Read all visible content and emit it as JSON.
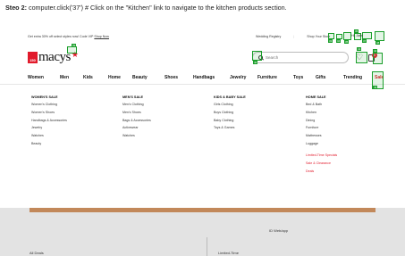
{
  "caption": {
    "step_label": "Steo 2:",
    "text": "computer.click('37')  # Click on the \"Kitchen\" link to navigate to the kitchen products section."
  },
  "header": {
    "promo_text": "Get extra 30% off select styles now! Code VIP",
    "promo_link": "Shop Now",
    "wedding_registry": "Wedding Registry",
    "shop_your_store": "Shop Your Store",
    "logo_badge": "150",
    "logo_text": "macys",
    "search_placeholder": "Search",
    "bag_count": "0",
    "sign_in": "Hi, Jane"
  },
  "nav": {
    "items": [
      "Women",
      "Men",
      "Kids",
      "Home",
      "Beauty",
      "Shoes",
      "Handbags",
      "Jewelry",
      "Furniture",
      "Toys",
      "Gifts",
      "Trending",
      "Sale"
    ]
  },
  "mega_menu": {
    "columns": [
      {
        "title": "WOMEN'S SALE",
        "items": [
          "Women's Clothing",
          "Women's Shoes",
          "Handbags & Accessories",
          "Jewelry",
          "Watches",
          "Beauty"
        ]
      },
      {
        "title": "MEN'S SALE",
        "items": [
          "Men's Clothing",
          "Men's Shoes",
          "Bags & Accessories",
          "Activewear",
          "Watches"
        ]
      },
      {
        "title": "KIDS & BABY SALE",
        "items": [
          "Girls Clothing",
          "Boys Clothing",
          "Baby Clothing",
          "Toys & Games"
        ]
      },
      {
        "title": "HOME SALE",
        "items": [
          "Bed & Bath",
          "Kitchen",
          "Dining",
          "Furniture",
          "Mattresses",
          "Luggage"
        ],
        "extra_items": [
          "Limited-Time Specials",
          "Sale & Clearance",
          "Deals"
        ]
      }
    ]
  },
  "footer": {
    "text_center": "ID Web/app",
    "text_left": "All Deals",
    "text_right": "Limited-Time"
  },
  "annotations": {
    "color": "#1a9e2a",
    "labels": [
      "33",
      "34",
      "35",
      "36",
      "37",
      "38",
      "39",
      "40",
      "41",
      "42",
      "43",
      "44",
      "45",
      "46",
      "47"
    ]
  }
}
